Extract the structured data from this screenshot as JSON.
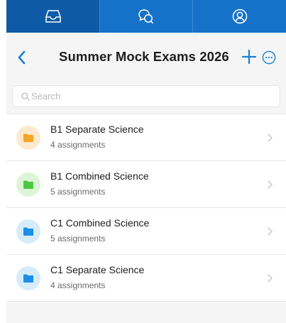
{
  "tabs": [
    {
      "icon": "inbox-tray-icon"
    },
    {
      "icon": "chat-bubbles-icon"
    },
    {
      "icon": "profile-icon"
    }
  ],
  "header": {
    "title": "Summer Mock Exams 2026",
    "back_icon": "chevron-left-icon",
    "add_icon": "plus-icon",
    "more_icon": "ellipsis-circle-icon"
  },
  "search": {
    "placeholder": "Search",
    "value": ""
  },
  "folders": [
    {
      "name": "B1 Separate Science",
      "count": "4 assignments",
      "color": "#f5a623",
      "bg": "#fde9cf"
    },
    {
      "name": "B1 Combined Science",
      "count": "5 assignments",
      "color": "#4cc93f",
      "bg": "#dcf5d6"
    },
    {
      "name": "C1 Combined Science",
      "count": "5 assignments",
      "color": "#1b8fe6",
      "bg": "#d6ecfb"
    },
    {
      "name": "C1 Separate Science",
      "count": "4 assignments",
      "color": "#1b8fe6",
      "bg": "#d6ecfb"
    }
  ],
  "colors": {
    "tab_active": "#0e5aa6",
    "tab_inactive": "#1672c8",
    "accent": "#1a7fd6"
  }
}
